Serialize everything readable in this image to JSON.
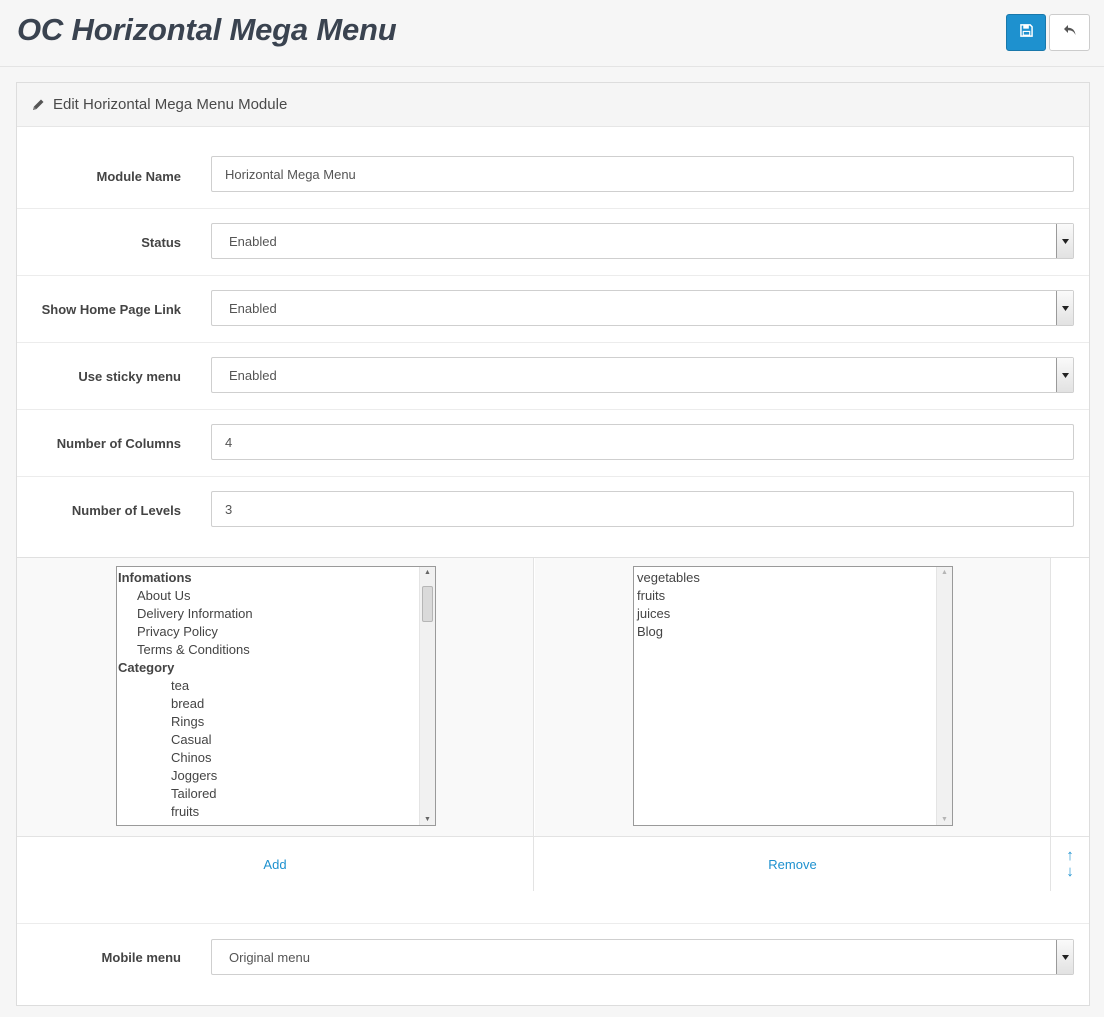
{
  "header": {
    "title": "OC Horizontal Mega Menu"
  },
  "panel": {
    "heading": "Edit Horizontal Mega Menu Module"
  },
  "form": {
    "module_name": {
      "label": "Module Name",
      "value": "Horizontal Mega Menu"
    },
    "status": {
      "label": "Status",
      "value": "Enabled"
    },
    "show_home": {
      "label": "Show Home Page Link",
      "value": "Enabled"
    },
    "sticky": {
      "label": "Use sticky menu",
      "value": "Enabled"
    },
    "columns": {
      "label": "Number of Columns",
      "value": "4"
    },
    "levels": {
      "label": "Number of Levels",
      "value": "3"
    },
    "mobile_menu": {
      "label": "Mobile menu",
      "value": "Original menu"
    }
  },
  "available_list": {
    "groups": [
      {
        "label": "Infomations",
        "items": [
          "About Us",
          "Delivery Information",
          "Privacy Policy",
          "Terms & Conditions"
        ]
      },
      {
        "label": "Category",
        "items": [
          "tea",
          "bread",
          "Rings",
          "Casual",
          "Chinos",
          "Joggers",
          "Tailored",
          "fruits"
        ]
      }
    ]
  },
  "selected_list": {
    "items": [
      "vegetables",
      "fruits",
      "juices",
      "Blog"
    ]
  },
  "actions": {
    "add": "Add",
    "remove": "Remove",
    "move_up": "↑",
    "move_down": "↓"
  }
}
